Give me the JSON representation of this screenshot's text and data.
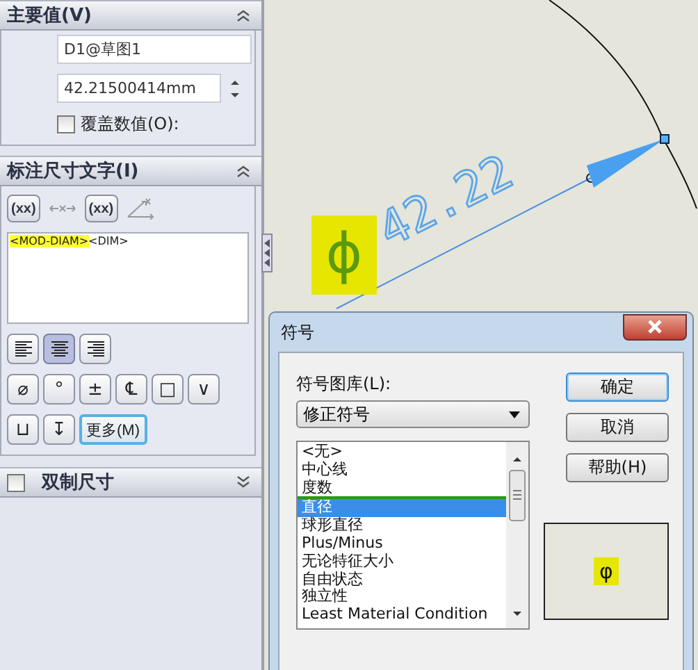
{
  "primary_value": {
    "title": "主要值(V)",
    "expanded": true,
    "name_field": "D1@草图1",
    "value_field": "42.21500414mm",
    "override": {
      "label": "覆盖数值(O):",
      "checked": false
    }
  },
  "dimension_text": {
    "title": "标注尺寸文字(I)",
    "expanded": true,
    "text_buttons": [
      {
        "kind": "text",
        "label": "(xx)"
      },
      {
        "kind": "arrows"
      },
      {
        "kind": "text",
        "label": "(xx)"
      },
      {
        "kind": "angle"
      }
    ],
    "text_parts": [
      {
        "text": "<MOD-DIAM>",
        "highlighted": true
      },
      {
        "text": "<DIM>",
        "highlighted": false
      }
    ],
    "alignment": [
      {
        "kind": "left",
        "selected": false
      },
      {
        "kind": "center",
        "selected": true
      },
      {
        "kind": "right",
        "selected": false
      }
    ],
    "symbol_rows": [
      [
        "⌀",
        "°",
        "±",
        "℄",
        "□",
        "∨"
      ],
      [
        "⊔",
        "↧"
      ]
    ],
    "more_button": {
      "label": "更多(M)",
      "focused": true
    }
  },
  "dual_dimension": {
    "label": "双制尺寸",
    "checked": false,
    "expanded": false
  },
  "canvas": {
    "symbol": "ϕ",
    "value": "42.22"
  },
  "dialog": {
    "title": "符号",
    "library_label": "符号图库(L):",
    "library": "修正符号",
    "symbols": [
      {
        "label": "<无>",
        "selected": false
      },
      {
        "label": "中心线",
        "selected": false
      },
      {
        "label": "度数",
        "selected": false
      },
      {
        "label": "直径",
        "selected": true
      },
      {
        "label": "球形直径",
        "selected": false
      },
      {
        "label": "Plus/Minus",
        "selected": false
      },
      {
        "label": "无论特征大小",
        "selected": false
      },
      {
        "label": "自由状态",
        "selected": false
      },
      {
        "label": "独立性",
        "selected": false
      },
      {
        "label": "Least Material Condition",
        "selected": false
      }
    ],
    "buttons": [
      {
        "label": "确定",
        "default": true
      },
      {
        "label": "取消",
        "default": false
      },
      {
        "label": "帮助(H)",
        "default": false
      }
    ],
    "preview": "φ"
  }
}
